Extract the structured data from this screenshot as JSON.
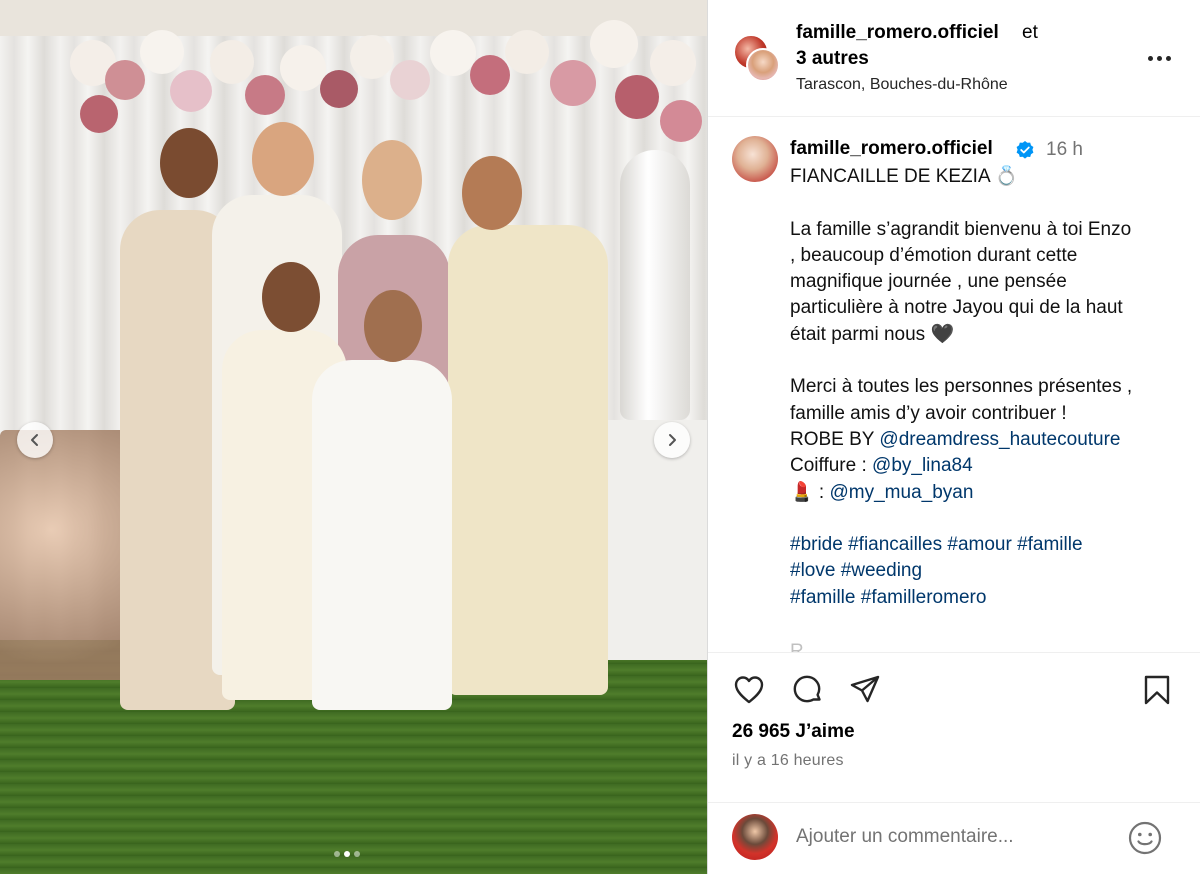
{
  "header": {
    "account": "famille_romero.officiel",
    "and_word": "et",
    "others": "3 autres",
    "location": "Tarascon, Bouches-du-Rhône"
  },
  "caption": {
    "username": "famille_romero.officiel",
    "time": "16 h",
    "lines": [
      "FIANCAILLE DE KEZIA 💍",
      "",
      "La famille s’agrandit bienvenu à toi Enzo",
      ", beaucoup d’émotion durant cette",
      "magnifique journée , une pensée",
      "particulière à notre Jayou qui de la haut",
      "était parmi nous 🖤",
      "",
      "Merci à toutes les personnes présentes ,",
      "famille amis d’y avoir contribuer !"
    ],
    "robe_prefix": "ROBE BY ",
    "robe_tag": "@dreamdress_hautecouture",
    "coiffure_prefix": "Coiffure : ",
    "coiffure_tag": "@by_lina84",
    "makeup_prefix": "💄 : ",
    "makeup_tag": "@my_mua_byan",
    "hashtag_lines": [
      "#bride #fiancailles #amour #famille",
      "#love #weeding",
      "#famille #familleromero"
    ],
    "faded_text": "R"
  },
  "actions": {
    "likes": "26 965 J’aime",
    "date": "il y a 16 heures"
  },
  "comment": {
    "placeholder": "Ajouter un commentaire..."
  },
  "carousel": {
    "slide_count": 3,
    "active_slide": 2
  },
  "colors": {
    "verified": "#0095f6",
    "link": "#00376b",
    "muted": "#737373"
  },
  "icons": [
    "more-icon",
    "verified-icon",
    "like-icon",
    "comment-icon",
    "share-icon",
    "save-icon",
    "emoji-icon",
    "chevron-left-icon",
    "chevron-right-icon"
  ]
}
